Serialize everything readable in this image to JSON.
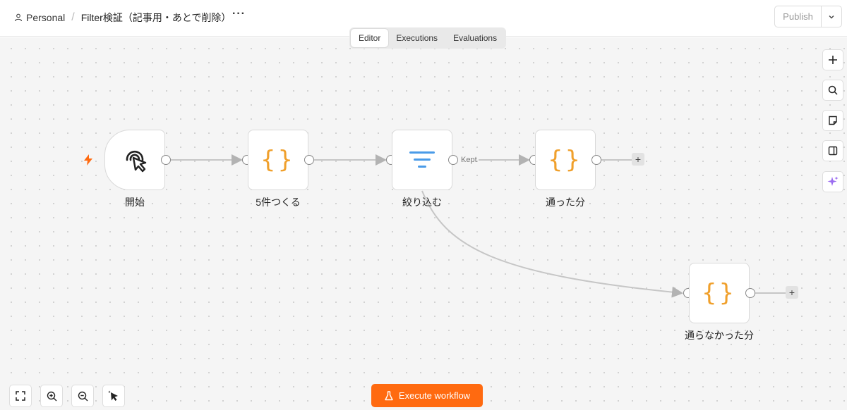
{
  "header": {
    "workspace": "Personal",
    "workflow_title": "Filter検証（記事用・あとで削除）",
    "more_label": "···",
    "publish_label": "Publish"
  },
  "tabs": [
    {
      "label": "Editor",
      "active": true
    },
    {
      "label": "Executions",
      "active": false
    },
    {
      "label": "Evaluations",
      "active": false
    }
  ],
  "nodes": {
    "start": {
      "label": "開始",
      "icon": "cursor-click-icon"
    },
    "make5": {
      "label": "5件つくる",
      "icon": "code-braces-icon"
    },
    "filter": {
      "label": "絞り込む",
      "icon": "filter-icon"
    },
    "passed": {
      "label": "通った分",
      "icon": "code-braces-icon"
    },
    "failed": {
      "label": "通らなかった分",
      "icon": "code-braces-icon"
    }
  },
  "edge_labels": {
    "kept": "Kept"
  },
  "brace_text": "{}",
  "add_symbol": "+",
  "execute_button": {
    "label": "Execute workflow"
  },
  "colors": {
    "accent": "#ff6a10",
    "braces": "#f0a02c",
    "filter": "#4a9be8",
    "trigger": "#ff6a10",
    "ai": "#9b6cf0"
  }
}
